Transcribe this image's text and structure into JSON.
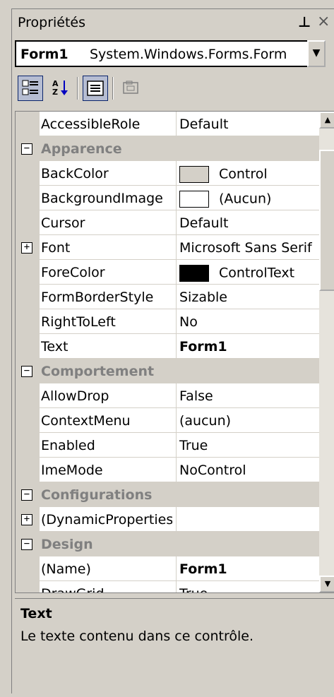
{
  "window": {
    "title": "Propriétés"
  },
  "object_selector": {
    "name": "Form1",
    "type": "System.Windows.Forms.Form"
  },
  "toolbar": {
    "buttons": [
      "categorized-view",
      "alphabetical-sort",
      "properties-view",
      "property-pages"
    ]
  },
  "grid": {
    "rows": [
      {
        "kind": "prop",
        "name": "AccessibleRole",
        "value": "Default"
      },
      {
        "kind": "cat",
        "name": "Apparence",
        "expander": "−"
      },
      {
        "kind": "prop",
        "name": "BackColor",
        "value": "Control",
        "swatch": "#d4d0c8"
      },
      {
        "kind": "prop",
        "name": "BackgroundImage",
        "value": "(Aucun)",
        "swatch": "#ffffff"
      },
      {
        "kind": "prop",
        "name": "Cursor",
        "value": "Default"
      },
      {
        "kind": "prop",
        "name": "Font",
        "value": "Microsoft Sans Serif",
        "expander": "+"
      },
      {
        "kind": "prop",
        "name": "ForeColor",
        "value": "ControlText",
        "swatch": "#000000"
      },
      {
        "kind": "prop",
        "name": "FormBorderStyle",
        "value": "Sizable"
      },
      {
        "kind": "prop",
        "name": "RightToLeft",
        "value": "No"
      },
      {
        "kind": "prop",
        "name": "Text",
        "value": "Form1",
        "bold": true
      },
      {
        "kind": "cat",
        "name": "Comportement",
        "expander": "−"
      },
      {
        "kind": "prop",
        "name": "AllowDrop",
        "value": "False"
      },
      {
        "kind": "prop",
        "name": "ContextMenu",
        "value": "(aucun)"
      },
      {
        "kind": "prop",
        "name": "Enabled",
        "value": "True"
      },
      {
        "kind": "prop",
        "name": "ImeMode",
        "value": "NoControl"
      },
      {
        "kind": "cat",
        "name": "Configurations",
        "expander": "−"
      },
      {
        "kind": "prop",
        "name": "(DynamicProperties",
        "value": "",
        "expander": "+"
      },
      {
        "kind": "cat",
        "name": "Design",
        "expander": "−"
      },
      {
        "kind": "prop",
        "name": "(Name)",
        "value": "Form1",
        "bold": true
      },
      {
        "kind": "prop",
        "name": "DrawGrid",
        "value": "True"
      }
    ]
  },
  "description": {
    "title": "Text",
    "text": "Le texte contenu dans ce contrôle."
  }
}
